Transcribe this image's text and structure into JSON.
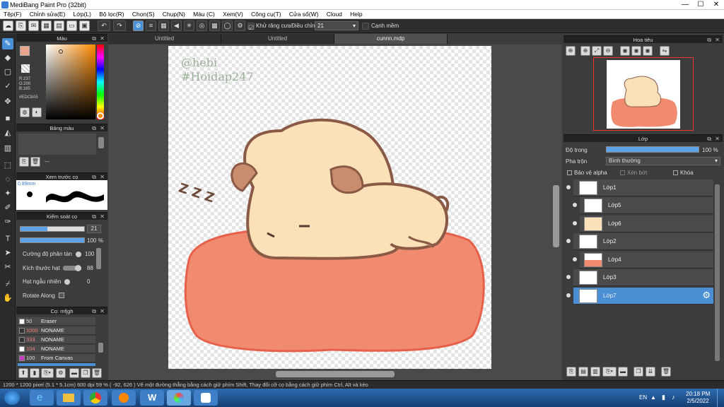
{
  "titlebar": {
    "title": "MediBang Paint Pro (32bit)",
    "min": "—",
    "max": "☐",
    "close": "✕"
  },
  "menu": [
    "Tệp(F)",
    "Chỉnh sửa(E)",
    "Lớp(L)",
    "Bộ lọc(R)",
    "Chọn(S)",
    "Chụp(N)",
    "Màu (C)",
    "Xem(V)",
    "Công cụ(T)",
    "Cửa sổ(W)",
    "Cloud",
    "Help"
  ],
  "toolbar": {
    "antialias": "Khử răng cưa",
    "adjust": "Điều chỉnh",
    "adjust_value": "21",
    "soft_edge": "Cạnh mềm"
  },
  "tabs": [
    "Untitled",
    "Untitled",
    "cunnn.mdp"
  ],
  "color_panel": {
    "title": "Màu",
    "r": "R:237",
    "g": "G:200",
    "b": "B:165",
    "hex": "#EDC8A5",
    "fg": "#e8a68f",
    "bg": "#ffffff"
  },
  "palette_panel": {
    "title": "Bảng màu",
    "dash": "---"
  },
  "preview_panel": {
    "title": "Xem trước cọ",
    "size": "0.89mm"
  },
  "brush_ctrl": {
    "title": "Kiểm soát cọ",
    "size_value": "21",
    "opacity_value": "100",
    "opacity_unit": "%",
    "scatter_label": "Cường độ phân tán",
    "scatter_value": "100",
    "particle_label": "Kích thước hạt",
    "particle_value": "88",
    "random_label": "Hạt ngẫu nhiên",
    "random_value": "0",
    "rotate_label": "Rotate Along"
  },
  "brush_list": {
    "title": "Cọ: mfjgh",
    "items": [
      {
        "size": "50",
        "name": "Eraser",
        "color": "#ffffff"
      },
      {
        "size": "1000",
        "name": "NONAME",
        "color": "#333333"
      },
      {
        "size": "333",
        "name": "NONAME",
        "color": "#333333"
      },
      {
        "size": "104",
        "name": "NONAME",
        "color": "#ffffff"
      },
      {
        "size": "100",
        "name": "From Canvas",
        "color": "#c040c0"
      }
    ]
  },
  "navigator": {
    "title": "Hoa tiêu"
  },
  "layer_panel": {
    "title": "Lớp",
    "opacity_label": "Độ trong",
    "opacity_value": "100 %",
    "blend_label": "Pha trộn",
    "blend_value": "Bình thường",
    "protect_alpha": "Bảo vệ alpha",
    "clip": "Xén bớt",
    "lock": "Khóa"
  },
  "layers": [
    {
      "name": "Lớp1",
      "indent": 0
    },
    {
      "name": "Lớp5",
      "indent": 1
    },
    {
      "name": "Lớp6",
      "indent": 1
    },
    {
      "name": "Lớp2",
      "indent": 0
    },
    {
      "name": "Lớp4",
      "indent": 1
    },
    {
      "name": "Lớp3",
      "indent": 0
    },
    {
      "name": "Lớp7",
      "indent": 0,
      "selected": true
    }
  ],
  "status": {
    "size": "1200 * 1200 pixel",
    "dims": "(5.1 * 5.1cm)",
    "dpi": "600 dpi",
    "zoom": "59 %",
    "coords": "( -92, 626 )",
    "hint": "Vẽ một đường thẳng bằng cách giữ phím Shift, Thay đổi cỡ cọ bằng cách giữ phím Ctrl, Alt và kéo"
  },
  "canvas_text": {
    "line1": "@hebi",
    "line2": "#Hoidap247",
    "zzz": "Z Z Z"
  },
  "taskbar": {
    "lang": "EN",
    "time": "20:18 PM",
    "date": "2/5/2022"
  }
}
